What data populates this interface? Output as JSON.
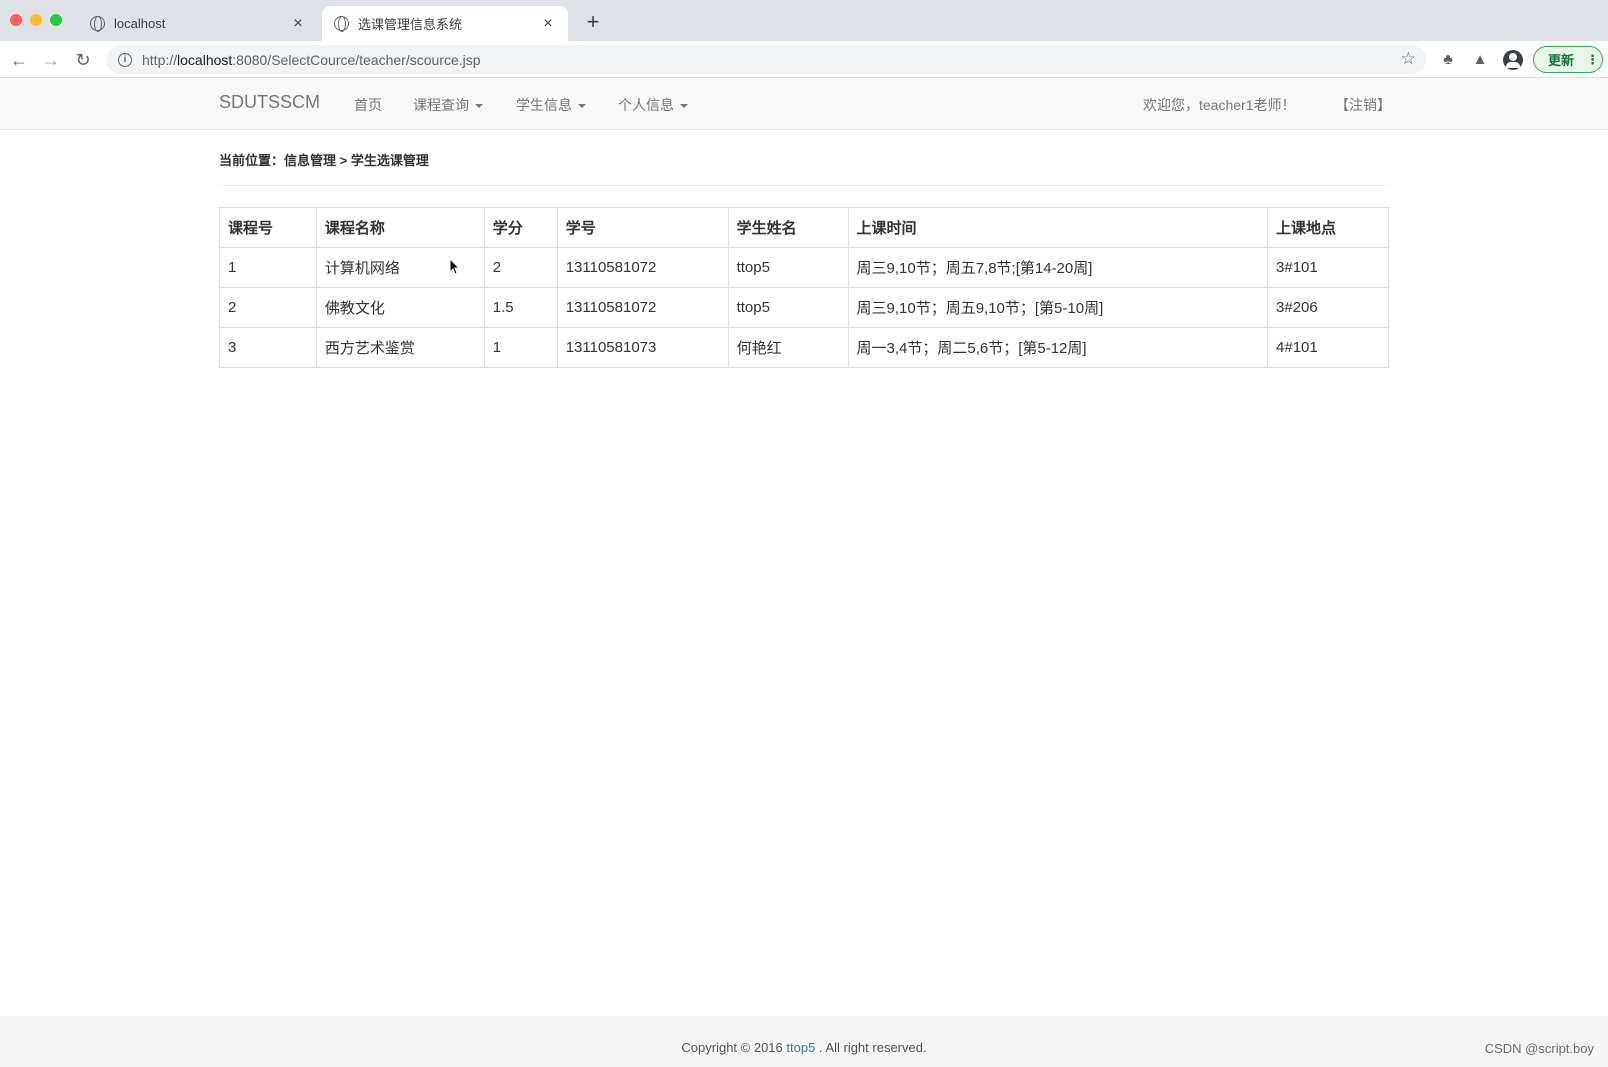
{
  "browser": {
    "tabs": [
      {
        "title": "localhost",
        "close": "×"
      },
      {
        "title": "选课管理信息系统",
        "close": "×"
      }
    ],
    "new_tab": "+",
    "url_scheme": "http://",
    "url_host": "localhost",
    "url_path": ":8080/SelectCource/teacher/scource.jsp",
    "update_label": "更新",
    "update_menu": "⋮"
  },
  "navbar": {
    "brand": "SDUTSSCM",
    "items": [
      "首页",
      "课程查询",
      "学生信息",
      "个人信息"
    ],
    "welcome": "欢迎您，teacher1老师！",
    "logout": "【注销】"
  },
  "breadcrumb": "当前位置：信息管理 > 学生选课管理",
  "table": {
    "headers": [
      "课程号",
      "课程名称",
      "学分",
      "学号",
      "学生姓名",
      "上课时间",
      "上课地点"
    ],
    "rows": [
      [
        "1",
        "计算机网络",
        "2",
        "13110581072",
        "ttop5",
        "周三9,10节；周五7,8节;[第14-20周]",
        "3#101"
      ],
      [
        "2",
        "佛教文化",
        "1.5",
        "13110581072",
        "ttop5",
        "周三9,10节；周五9,10节；[第5-10周]",
        "3#206"
      ],
      [
        "3",
        "西方艺术鉴赏",
        "1",
        "13110581073",
        "何艳红",
        "周一3,4节；周二5,6节；[第5-12周]",
        "4#101"
      ]
    ]
  },
  "footer": {
    "prefix": "Copyright © 2016 ",
    "link": "ttop5",
    "suffix": " . All right reserved."
  },
  "watermark": "CSDN @script.boy",
  "icons": {
    "back": "back-arrow-icon",
    "forward": "forward-arrow-icon",
    "reload": "reload-icon",
    "info": "info-icon",
    "star": "star-icon",
    "extensions": "puzzle-icon",
    "labs": "flask-icon",
    "account": "account-icon"
  }
}
